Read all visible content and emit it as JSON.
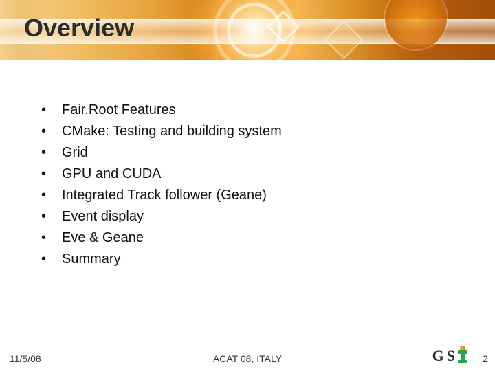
{
  "title": "Overview",
  "bullets": [
    "Fair.Root Features",
    "CMake: Testing and building system",
    "Grid",
    "GPU and CUDA",
    "Integrated Track follower (Geane)",
    "Event display",
    "Eve  & Geane",
    "Summary"
  ],
  "footer": {
    "date": "11/5/08",
    "venue": "ACAT 08, ITALY",
    "page": "2",
    "logo": {
      "g": "G",
      "s": "S"
    }
  }
}
